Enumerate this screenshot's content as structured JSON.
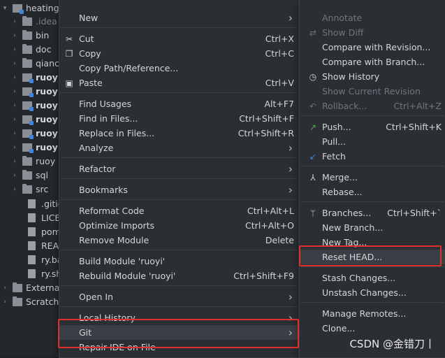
{
  "tree": {
    "rows": [
      {
        "label": "heating",
        "kind": "folder-module",
        "arrow": "▾",
        "indent": 0,
        "style": ""
      },
      {
        "label": ".idea",
        "kind": "folder",
        "arrow": "›",
        "indent": 1,
        "style": "dim"
      },
      {
        "label": "bin",
        "kind": "folder",
        "arrow": "›",
        "indent": 1,
        "style": ""
      },
      {
        "label": "doc",
        "kind": "folder",
        "arrow": "›",
        "indent": 1,
        "style": ""
      },
      {
        "label": "qianc",
        "kind": "folder",
        "arrow": "›",
        "indent": 1,
        "style": ""
      },
      {
        "label": "ruoy",
        "kind": "folder-module",
        "arrow": "›",
        "indent": 1,
        "style": "bold"
      },
      {
        "label": "ruoy",
        "kind": "folder-module",
        "arrow": "›",
        "indent": 1,
        "style": "bold"
      },
      {
        "label": "ruoy",
        "kind": "folder-module",
        "arrow": "›",
        "indent": 1,
        "style": "bold"
      },
      {
        "label": "ruoy",
        "kind": "folder-module",
        "arrow": "›",
        "indent": 1,
        "style": "bold"
      },
      {
        "label": "ruoy",
        "kind": "folder-module",
        "arrow": "›",
        "indent": 1,
        "style": "bold"
      },
      {
        "label": "ruoy",
        "kind": "folder-module",
        "arrow": "›",
        "indent": 1,
        "style": "bold"
      },
      {
        "label": "ruoy",
        "kind": "folder",
        "arrow": "›",
        "indent": 1,
        "style": ""
      },
      {
        "label": "sql",
        "kind": "folder",
        "arrow": "›",
        "indent": 1,
        "style": ""
      },
      {
        "label": "src",
        "kind": "folder",
        "arrow": "›",
        "indent": 1,
        "style": ""
      },
      {
        "label": ".gitig",
        "kind": "file",
        "arrow": "",
        "indent": 2,
        "style": ""
      },
      {
        "label": "LICE",
        "kind": "file",
        "arrow": "",
        "indent": 2,
        "style": ""
      },
      {
        "label": "pom",
        "kind": "file",
        "arrow": "",
        "indent": 2,
        "style": ""
      },
      {
        "label": "READ",
        "kind": "file",
        "arrow": "",
        "indent": 2,
        "style": ""
      },
      {
        "label": "ry.ba",
        "kind": "file",
        "arrow": "",
        "indent": 2,
        "style": ""
      },
      {
        "label": "ry.sh",
        "kind": "file",
        "arrow": "",
        "indent": 2,
        "style": ""
      },
      {
        "label": "Externa",
        "kind": "folder",
        "arrow": "›",
        "indent": 0,
        "style": ""
      },
      {
        "label": "Scratche",
        "kind": "folder",
        "arrow": "›",
        "indent": 0,
        "style": ""
      }
    ]
  },
  "context_menu": {
    "items": [
      {
        "label": "New",
        "shortcut": "",
        "submenu": true,
        "icon": ""
      },
      {
        "sep": true
      },
      {
        "label": "Cut",
        "shortcut": "Ctrl+X",
        "submenu": false,
        "icon": "scissors-icon"
      },
      {
        "label": "Copy",
        "shortcut": "Ctrl+C",
        "submenu": false,
        "icon": "copy-icon"
      },
      {
        "label": "Copy Path/Reference...",
        "shortcut": "",
        "submenu": false,
        "icon": ""
      },
      {
        "label": "Paste",
        "shortcut": "Ctrl+V",
        "submenu": false,
        "icon": "clipboard-icon"
      },
      {
        "sep": true
      },
      {
        "label": "Find Usages",
        "shortcut": "Alt+F7",
        "submenu": false,
        "icon": ""
      },
      {
        "label": "Find in Files...",
        "shortcut": "Ctrl+Shift+F",
        "submenu": false,
        "icon": ""
      },
      {
        "label": "Replace in Files...",
        "shortcut": "Ctrl+Shift+R",
        "submenu": false,
        "icon": ""
      },
      {
        "label": "Analyze",
        "shortcut": "",
        "submenu": true,
        "icon": ""
      },
      {
        "sep": true
      },
      {
        "label": "Refactor",
        "shortcut": "",
        "submenu": true,
        "icon": ""
      },
      {
        "sep": true
      },
      {
        "label": "Bookmarks",
        "shortcut": "",
        "submenu": true,
        "icon": ""
      },
      {
        "sep": true
      },
      {
        "label": "Reformat Code",
        "shortcut": "Ctrl+Alt+L",
        "submenu": false,
        "icon": ""
      },
      {
        "label": "Optimize Imports",
        "shortcut": "Ctrl+Alt+O",
        "submenu": false,
        "icon": ""
      },
      {
        "label": "Remove Module",
        "shortcut": "Delete",
        "submenu": false,
        "icon": ""
      },
      {
        "sep": true
      },
      {
        "label": "Build Module 'ruoyi'",
        "shortcut": "",
        "submenu": false,
        "icon": ""
      },
      {
        "label": "Rebuild Module 'ruoyi'",
        "shortcut": "Ctrl+Shift+F9",
        "submenu": false,
        "icon": ""
      },
      {
        "sep": true
      },
      {
        "label": "Open In",
        "shortcut": "",
        "submenu": true,
        "icon": ""
      },
      {
        "sep": true
      },
      {
        "label": "Local History",
        "shortcut": "",
        "submenu": true,
        "icon": ""
      },
      {
        "label": "Git",
        "shortcut": "",
        "submenu": true,
        "icon": "",
        "selected": true
      },
      {
        "label": "Repair IDE on File",
        "shortcut": "",
        "submenu": false,
        "icon": ""
      }
    ]
  },
  "git_menu": {
    "items": [
      {
        "label": "Annotate",
        "shortcut": "",
        "disabled": true,
        "icon": ""
      },
      {
        "label": "Show Diff",
        "shortcut": "",
        "disabled": true,
        "icon": "diff-icon"
      },
      {
        "label": "Compare with Revision...",
        "shortcut": "",
        "disabled": false,
        "icon": ""
      },
      {
        "label": "Compare with Branch...",
        "shortcut": "",
        "disabled": false,
        "icon": ""
      },
      {
        "label": "Show History",
        "shortcut": "",
        "disabled": false,
        "icon": "history-icon"
      },
      {
        "label": "Show Current Revision",
        "shortcut": "",
        "disabled": true,
        "icon": ""
      },
      {
        "label": "Rollback...",
        "shortcut": "Ctrl+Alt+Z",
        "disabled": true,
        "icon": "rollback-icon"
      },
      {
        "sep": true
      },
      {
        "label": "Push...",
        "shortcut": "Ctrl+Shift+K",
        "disabled": false,
        "icon": "push-icon"
      },
      {
        "label": "Pull...",
        "shortcut": "",
        "disabled": false,
        "icon": ""
      },
      {
        "label": "Fetch",
        "shortcut": "",
        "disabled": false,
        "icon": "fetch-icon"
      },
      {
        "sep": true
      },
      {
        "label": "Merge...",
        "shortcut": "",
        "disabled": false,
        "icon": "merge-icon"
      },
      {
        "label": "Rebase...",
        "shortcut": "",
        "disabled": false,
        "icon": ""
      },
      {
        "sep": true
      },
      {
        "label": "Branches...",
        "shortcut": "Ctrl+Shift+`",
        "disabled": false,
        "icon": "branch-icon"
      },
      {
        "label": "New Branch...",
        "shortcut": "",
        "disabled": false,
        "icon": ""
      },
      {
        "label": "New Tag...",
        "shortcut": "",
        "disabled": false,
        "icon": ""
      },
      {
        "label": "Reset HEAD...",
        "shortcut": "",
        "disabled": false,
        "icon": "",
        "selected": true
      },
      {
        "sep": true
      },
      {
        "label": "Stash Changes...",
        "shortcut": "",
        "disabled": false,
        "icon": ""
      },
      {
        "label": "Unstash Changes...",
        "shortcut": "",
        "disabled": false,
        "icon": ""
      },
      {
        "sep": true
      },
      {
        "label": "Manage Remotes...",
        "shortcut": "",
        "disabled": false,
        "icon": ""
      },
      {
        "label": "Clone...",
        "shortcut": "",
        "disabled": false,
        "icon": ""
      }
    ]
  },
  "watermark": "CSDN @金错刀丨",
  "colors": {
    "highlight": "#e0302d",
    "menu_bg": "#2b2e33",
    "push_icon": "#4caf50",
    "fetch_icon": "#3f86d6"
  }
}
